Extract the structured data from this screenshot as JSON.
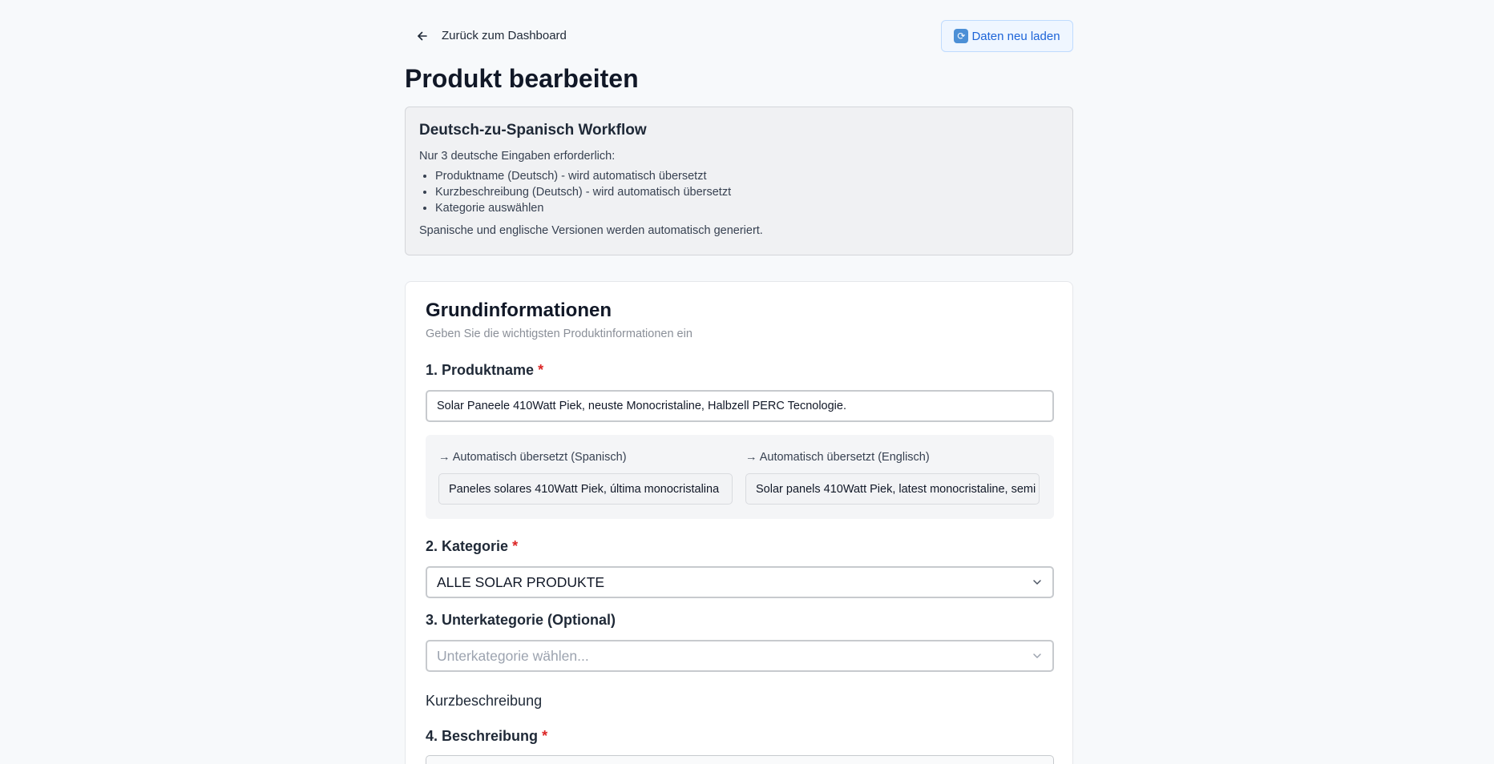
{
  "nav": {
    "back_label": "Zurück zum Dashboard",
    "reload_label": "Daten neu laden"
  },
  "page": {
    "title": "Produkt bearbeiten"
  },
  "workflow": {
    "title": "Deutsch-zu-Spanisch Workflow",
    "intro": "Nur 3 deutsche Eingaben erforderlich:",
    "items": [
      "Produktname (Deutsch) - wird automatisch übersetzt",
      "Kurzbeschreibung (Deutsch) - wird automatisch übersetzt",
      "Kategorie auswählen"
    ],
    "footer": "Spanische und englische Versionen werden automatisch generiert."
  },
  "basic_info": {
    "title": "Grundinformationen",
    "subtitle": "Geben Sie die wichtigsten Produktinformationen ein",
    "product_name": {
      "label": "1. Produktname",
      "required_mark": "*",
      "value": "Solar Paneele 410Watt Piek, neuste Monocristaline, Halbzell PERC Tecnologie."
    },
    "translations": {
      "spanish_label": "→ Automatisch übersetzt (Spanisch)",
      "spanish_value": "Paneles solares 410Watt Piek, última monocristalina",
      "english_label": "→ Automatisch übersetzt (Englisch)",
      "english_value": "Solar panels 410Watt Piek, latest monocristaline, semi"
    },
    "category": {
      "label": "2. Kategorie",
      "required_mark": "*",
      "value": "ALLE SOLAR PRODUKTE"
    },
    "subcategory": {
      "label": "3. Unterkategorie (Optional)",
      "placeholder": "Unterkategorie wählen..."
    },
    "short_description": {
      "label": "Kurzbeschreibung"
    },
    "description": {
      "label": "4. Beschreibung",
      "required_mark": "*"
    }
  },
  "colors": {
    "accent": "#1d64d8",
    "required": "#dc2626",
    "background": "#f7f9fb"
  }
}
